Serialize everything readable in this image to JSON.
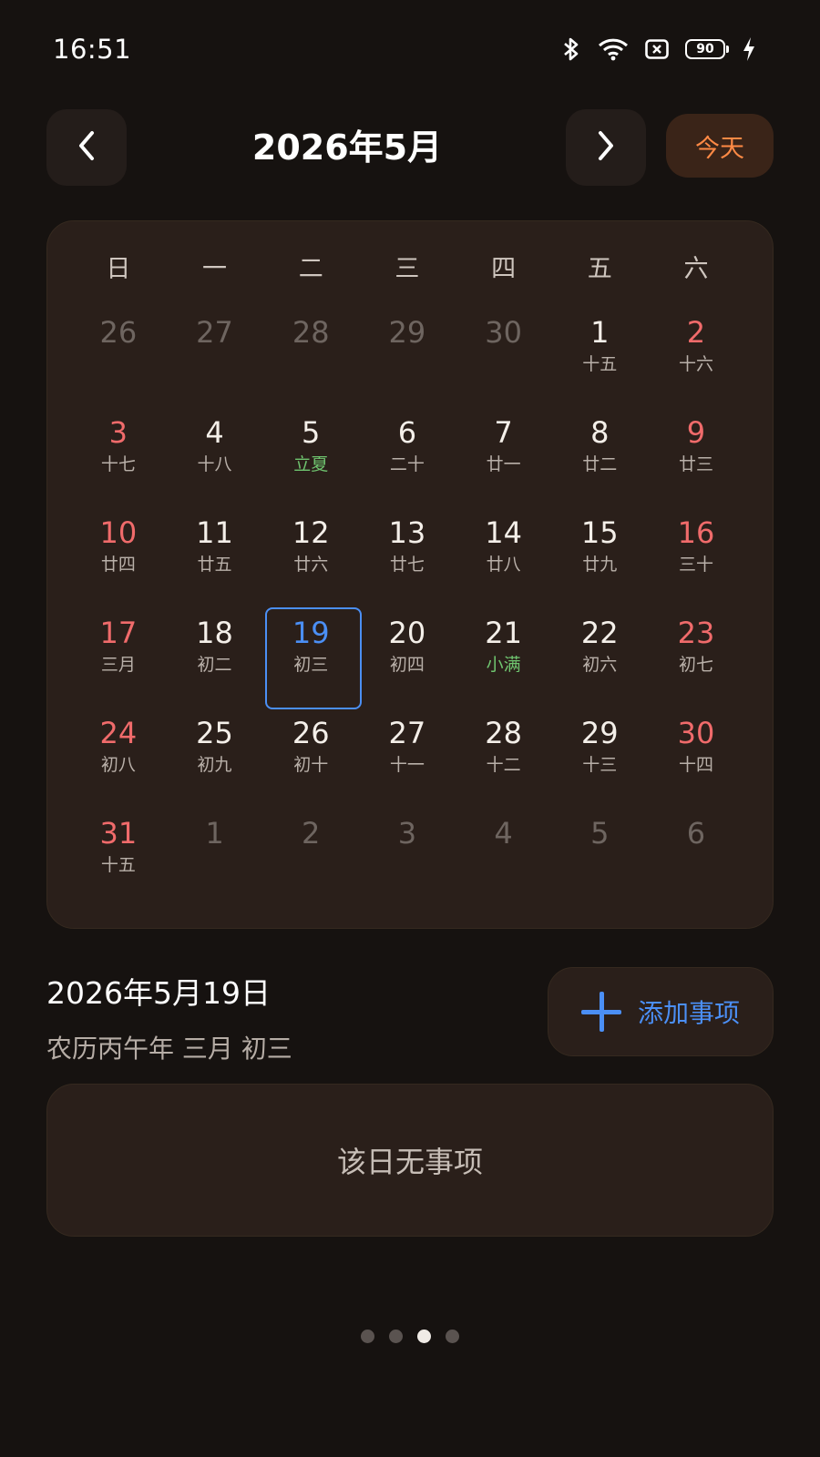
{
  "status_bar": {
    "time": "16:51",
    "battery": "90",
    "icons": [
      "bluetooth-icon",
      "wifi-icon",
      "sim-icon",
      "battery-icon",
      "charging-icon"
    ]
  },
  "header": {
    "month_title": "2026年5月",
    "today_label": "今天",
    "prev_icon": "chevron-left-icon",
    "next_icon": "chevron-right-icon"
  },
  "calendar": {
    "weekdays": [
      "日",
      "一",
      "二",
      "三",
      "四",
      "五",
      "六"
    ],
    "days": [
      {
        "num": "26",
        "lunar": "",
        "type": "other"
      },
      {
        "num": "27",
        "lunar": "",
        "type": "other"
      },
      {
        "num": "28",
        "lunar": "",
        "type": "other"
      },
      {
        "num": "29",
        "lunar": "",
        "type": "other"
      },
      {
        "num": "30",
        "lunar": "",
        "type": "other"
      },
      {
        "num": "1",
        "lunar": "十五",
        "type": "normal"
      },
      {
        "num": "2",
        "lunar": "十六",
        "type": "weekend"
      },
      {
        "num": "3",
        "lunar": "十七",
        "type": "weekend"
      },
      {
        "num": "4",
        "lunar": "十八",
        "type": "normal"
      },
      {
        "num": "5",
        "lunar": "立夏",
        "type": "term"
      },
      {
        "num": "6",
        "lunar": "二十",
        "type": "normal"
      },
      {
        "num": "7",
        "lunar": "廿一",
        "type": "normal"
      },
      {
        "num": "8",
        "lunar": "廿二",
        "type": "normal"
      },
      {
        "num": "9",
        "lunar": "廿三",
        "type": "weekend"
      },
      {
        "num": "10",
        "lunar": "廿四",
        "type": "weekend"
      },
      {
        "num": "11",
        "lunar": "廿五",
        "type": "normal"
      },
      {
        "num": "12",
        "lunar": "廿六",
        "type": "normal"
      },
      {
        "num": "13",
        "lunar": "廿七",
        "type": "normal"
      },
      {
        "num": "14",
        "lunar": "廿八",
        "type": "normal"
      },
      {
        "num": "15",
        "lunar": "廿九",
        "type": "normal"
      },
      {
        "num": "16",
        "lunar": "三十",
        "type": "weekend"
      },
      {
        "num": "17",
        "lunar": "三月",
        "type": "weekend"
      },
      {
        "num": "18",
        "lunar": "初二",
        "type": "normal"
      },
      {
        "num": "19",
        "lunar": "初三",
        "type": "selected"
      },
      {
        "num": "20",
        "lunar": "初四",
        "type": "normal"
      },
      {
        "num": "21",
        "lunar": "小满",
        "type": "term"
      },
      {
        "num": "22",
        "lunar": "初六",
        "type": "normal"
      },
      {
        "num": "23",
        "lunar": "初七",
        "type": "weekend"
      },
      {
        "num": "24",
        "lunar": "初八",
        "type": "weekend"
      },
      {
        "num": "25",
        "lunar": "初九",
        "type": "normal"
      },
      {
        "num": "26",
        "lunar": "初十",
        "type": "normal"
      },
      {
        "num": "27",
        "lunar": "十一",
        "type": "normal"
      },
      {
        "num": "28",
        "lunar": "十二",
        "type": "normal"
      },
      {
        "num": "29",
        "lunar": "十三",
        "type": "normal"
      },
      {
        "num": "30",
        "lunar": "十四",
        "type": "weekend"
      },
      {
        "num": "31",
        "lunar": "十五",
        "type": "weekend"
      },
      {
        "num": "1",
        "lunar": "",
        "type": "other"
      },
      {
        "num": "2",
        "lunar": "",
        "type": "other"
      },
      {
        "num": "3",
        "lunar": "",
        "type": "other"
      },
      {
        "num": "4",
        "lunar": "",
        "type": "other"
      },
      {
        "num": "5",
        "lunar": "",
        "type": "other"
      },
      {
        "num": "6",
        "lunar": "",
        "type": "other"
      }
    ]
  },
  "selected": {
    "date": "2026年5月19日",
    "lunar": "农历丙午年 三月 初三"
  },
  "actions": {
    "add_label": "添加事项"
  },
  "events": {
    "empty_text": "该日无事项"
  },
  "pager": {
    "count": 4,
    "active_index": 2
  },
  "colors": {
    "accent_blue": "#4b8ff5",
    "accent_orange": "#ff8a45",
    "weekend_red": "#f06b6b",
    "solar_term_green": "#6fc46f"
  }
}
